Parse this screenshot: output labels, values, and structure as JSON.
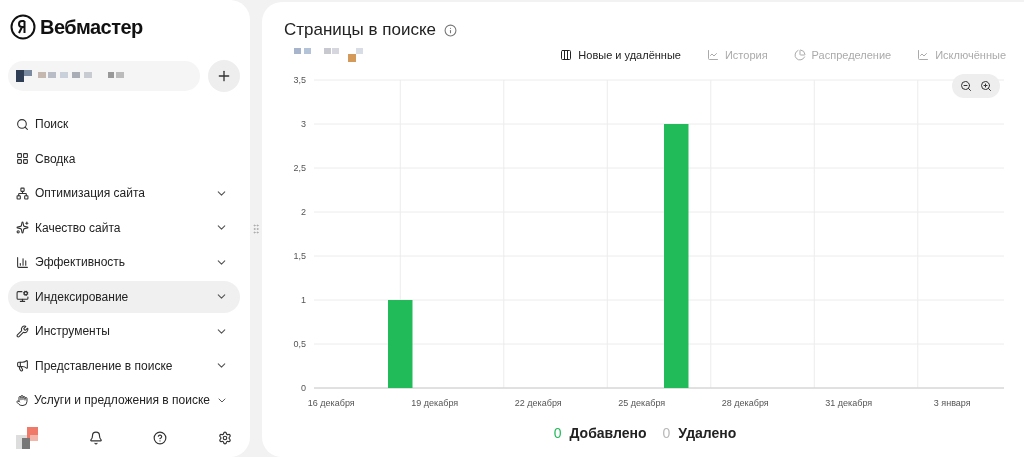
{
  "sidebar": {
    "logo": "Вебмастер",
    "items": [
      {
        "label": "Поиск",
        "kind": "search",
        "expandable": false,
        "selected": false
      },
      {
        "label": "Сводка",
        "kind": "summary",
        "expandable": false,
        "selected": false
      },
      {
        "label": "Оптимизация сайта",
        "kind": "optimization",
        "expandable": true,
        "selected": false
      },
      {
        "label": "Качество сайта",
        "kind": "quality",
        "expandable": true,
        "selected": false
      },
      {
        "label": "Эффективность",
        "kind": "efficiency",
        "expandable": true,
        "selected": false
      },
      {
        "label": "Индексирование",
        "kind": "indexing",
        "expandable": true,
        "selected": true
      },
      {
        "label": "Инструменты",
        "kind": "tools",
        "expandable": true,
        "selected": false
      },
      {
        "label": "Представление в поиске",
        "kind": "presentation",
        "expandable": true,
        "selected": false
      },
      {
        "label": "Услуги и предложения в поиске",
        "kind": "services",
        "expandable": true,
        "selected": false
      }
    ]
  },
  "main": {
    "title": "Страницы в поиске",
    "tabs": [
      {
        "label": "Новые и удалённые",
        "kind": "table",
        "selected": true
      },
      {
        "label": "История",
        "kind": "history",
        "selected": false
      },
      {
        "label": "Распределение",
        "kind": "pie",
        "selected": false
      },
      {
        "label": "Исключённые",
        "kind": "history",
        "selected": false
      }
    ],
    "chart_data": {
      "type": "bar",
      "grid": true,
      "categories": [
        "16 декабря",
        null,
        null,
        "19 декабря",
        null,
        null,
        "22 декабря",
        null,
        null,
        "25 декабря",
        null,
        null,
        "28 декабря",
        null,
        null,
        "31 декабря",
        null,
        null,
        "3 января",
        null
      ],
      "series": [
        {
          "name": "Добавлено",
          "color": "#22bb5a",
          "values": [
            0,
            0,
            1,
            0,
            0,
            0,
            0,
            0,
            0,
            0,
            3,
            0,
            0,
            0,
            0,
            0,
            0,
            0,
            0,
            0
          ]
        }
      ],
      "ylim": [
        0,
        3.5
      ],
      "yticks": [
        {
          "value": 0,
          "label": "0"
        },
        {
          "value": 0.5,
          "label": "0,5"
        },
        {
          "value": 1,
          "label": "1"
        },
        {
          "value": 1.5,
          "label": "1,5"
        },
        {
          "value": 2,
          "label": "2"
        },
        {
          "value": 2.5,
          "label": "2,5"
        },
        {
          "value": 3,
          "label": "3"
        },
        {
          "value": 3.5,
          "label": "3,5"
        }
      ]
    },
    "legend": [
      {
        "count": "0",
        "color": "#22bb5a"
      },
      {
        "count": "0",
        "label": "Удалено",
        "color": "#b8b8b8"
      }
    ]
  }
}
